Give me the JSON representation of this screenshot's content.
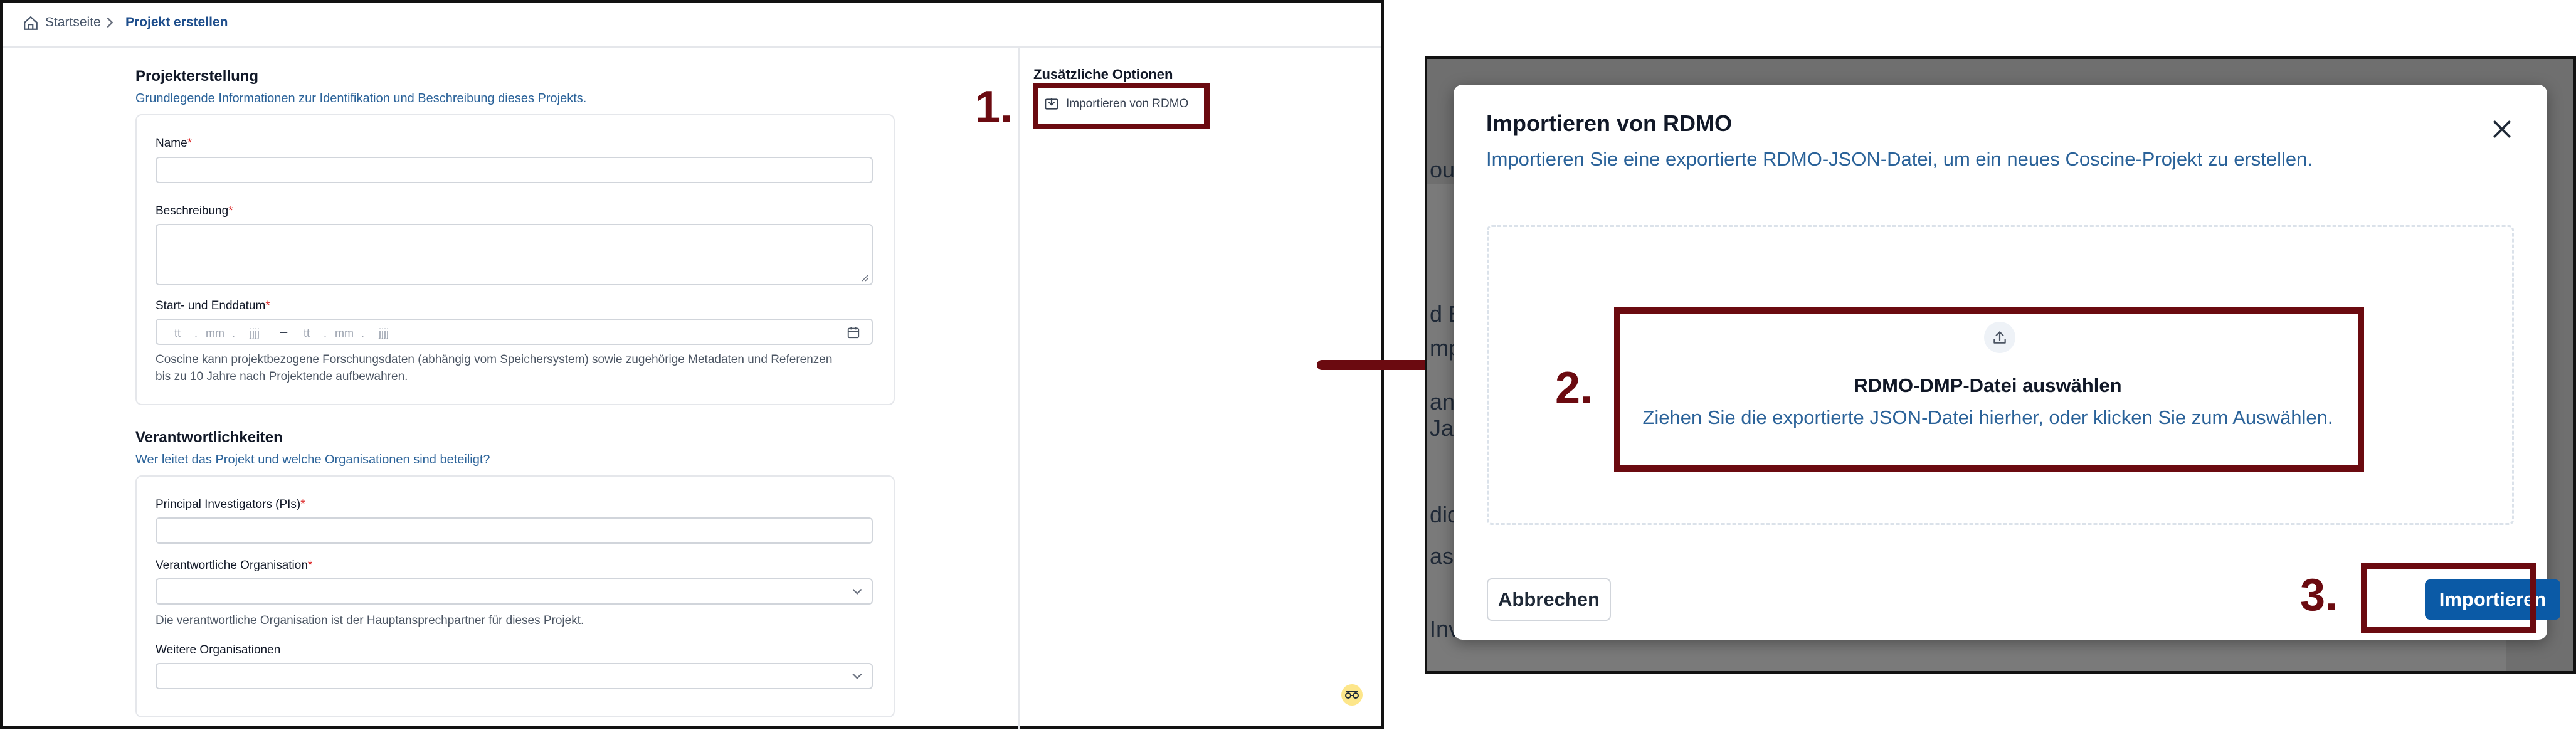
{
  "left_screen": {
    "breadcrumb": {
      "home": "Startseite",
      "current": "Projekt erstellen"
    },
    "section_project": {
      "title": "Projekterstellung",
      "description": "Grundlegende Informationen zur Identifikation und Beschreibung dieses Projekts.",
      "name_label": "Name",
      "description_label": "Beschreibung",
      "dates_label": "Start- und Enddatum",
      "date_start": {
        "day": "tt",
        "month": "mm",
        "year": "jjjj"
      },
      "date_end": {
        "day": "tt",
        "month": "mm",
        "year": "jjjj"
      },
      "date_separator": "–",
      "retention_hint_line1": "Coscine kann projektbezogene Forschungsdaten (abhängig vom Speichersystem) sowie zugehörige Metadaten und Referenzen",
      "retention_hint_line2": "bis zu 10 Jahre nach Projektende aufbewahren."
    },
    "section_responsibilities": {
      "title": "Verantwortlichkeiten",
      "description": "Wer leitet das Projekt und welche Organisationen sind beteiligt?",
      "pi_label": "Principal Investigators (PIs)",
      "org_label": "Verantwortliche Organisation",
      "org_hint": "Die verantwortliche Organisation ist der Hauptansprechpartner für dieses Projekt.",
      "more_orgs_label": "Weitere Organisationen"
    },
    "required_marker": "*",
    "sidebar": {
      "title": "Zusätzliche Optionen",
      "import_link": "Importieren von RDMO"
    }
  },
  "annotations": {
    "step1": "1.",
    "step2": "2.",
    "step3": "3."
  },
  "right_screen": {
    "background_fragments": [
      "oun",
      "d Er",
      "mp",
      "an",
      "Jah",
      "dic",
      "as P",
      "Inv"
    ],
    "modal": {
      "title": "Importieren von RDMO",
      "subtitle": "Importieren Sie eine exportierte RDMO-JSON-Datei, um ein neues Coscine-Projekt zu erstellen.",
      "dropzone_title": "RDMO-DMP-Datei auswählen",
      "dropzone_description": "Ziehen Sie die exportierte JSON-Datei hierher, oder klicken Sie zum Auswählen.",
      "cancel_label": "Abbrechen",
      "import_label": "Importieren"
    }
  },
  "colors": {
    "annotation": "#6b0a10",
    "primary": "#0b5aa6",
    "link": "#1e4e8c",
    "required": "#dc2626"
  },
  "icons": [
    "home-icon",
    "chevron-right-icon",
    "import-icon",
    "calendar-icon",
    "chevron-down-icon",
    "helper-icon",
    "close-icon",
    "upload-icon",
    "arrow-right-icon"
  ]
}
